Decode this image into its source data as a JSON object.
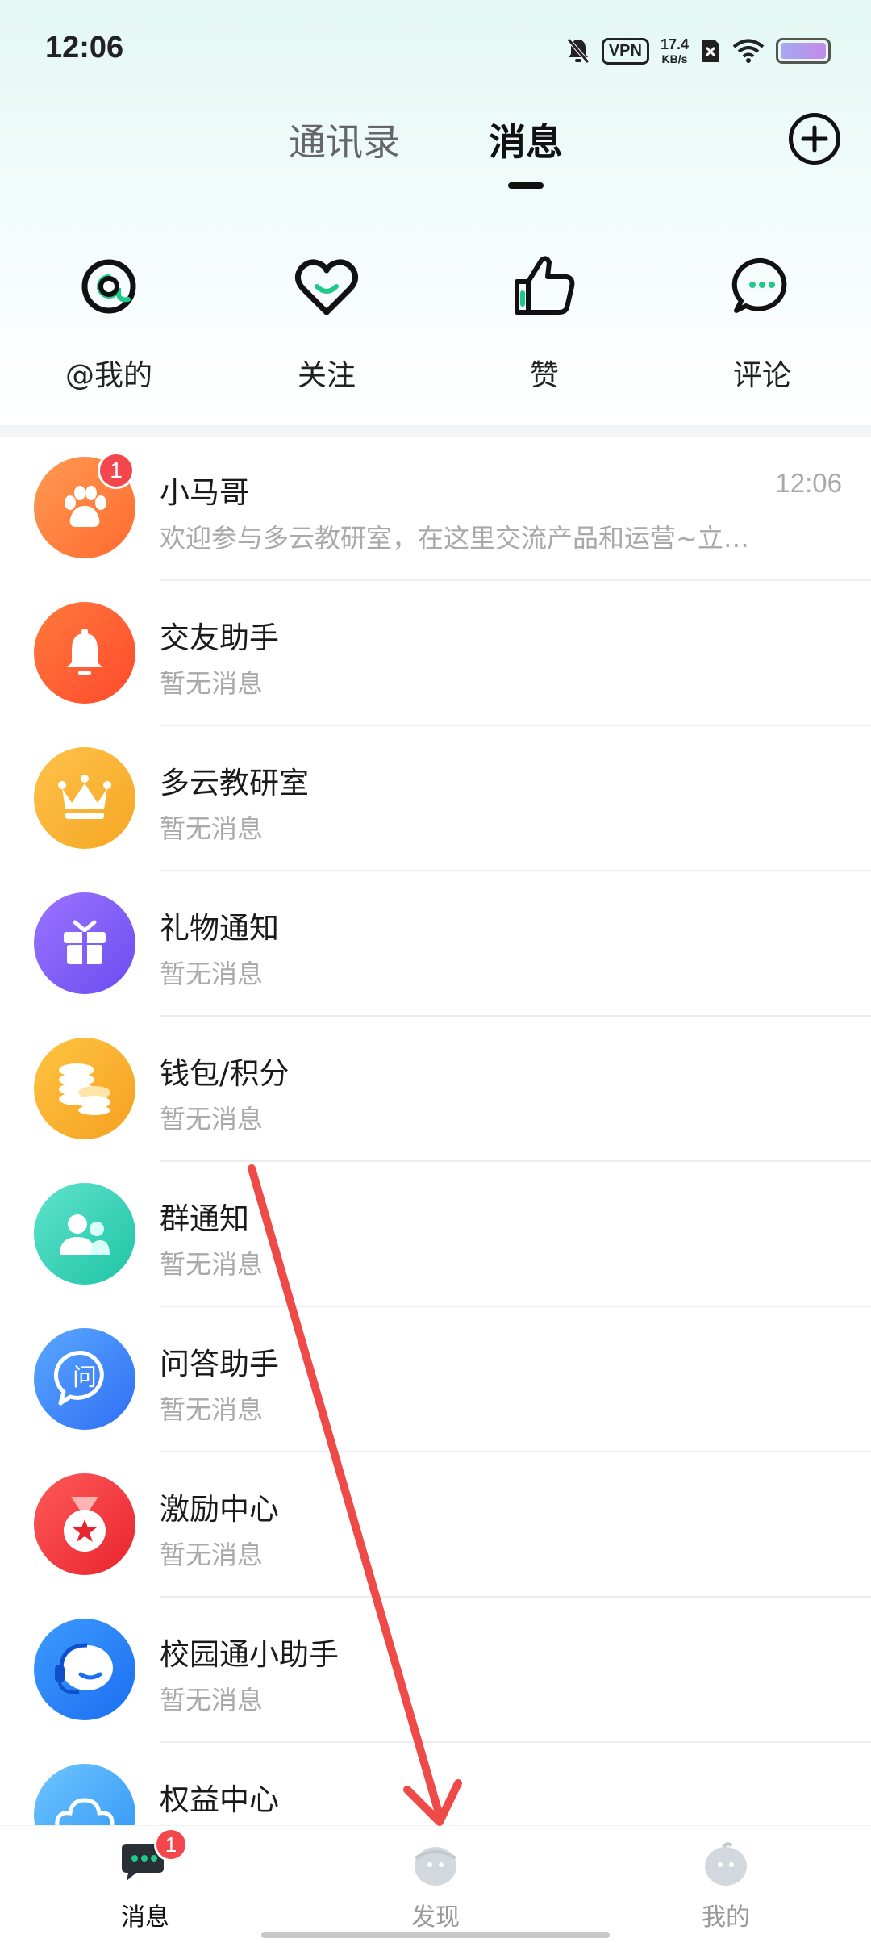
{
  "status_bar": {
    "time": "12:06",
    "vpn": "VPN",
    "speed_value": "17.4",
    "speed_unit": "KB/s"
  },
  "header": {
    "tabs": [
      {
        "label": "通讯录",
        "active": false
      },
      {
        "label": "消息",
        "active": true
      }
    ]
  },
  "quick_actions": [
    {
      "label": "@我的",
      "icon": "at-icon"
    },
    {
      "label": "关注",
      "icon": "heart-icon"
    },
    {
      "label": "赞",
      "icon": "thumbs-up-icon"
    },
    {
      "label": "评论",
      "icon": "comment-icon"
    }
  ],
  "conversations": [
    {
      "title": "小马哥",
      "preview": "欢迎参与多云教研室，在这里交流产品和运营~立…",
      "time": "12:06",
      "badge": "1",
      "color_from": "#ff9a52",
      "color_to": "#ff6a2f",
      "icon": "paw-icon"
    },
    {
      "title": "交友助手",
      "preview": "暂无消息",
      "color_from": "#ff7a3c",
      "color_to": "#ff4a2d",
      "icon": "bell-icon"
    },
    {
      "title": "多云教研室",
      "preview": "暂无消息",
      "color_from": "#ffc24a",
      "color_to": "#f5a623",
      "icon": "crown-icon"
    },
    {
      "title": "礼物通知",
      "preview": "暂无消息",
      "color_from": "#9b74ff",
      "color_to": "#6a4cf0",
      "icon": "gift-icon"
    },
    {
      "title": "钱包/积分",
      "preview": "暂无消息",
      "color_from": "#ffc442",
      "color_to": "#f5a020",
      "icon": "coins-icon"
    },
    {
      "title": "群通知",
      "preview": "暂无消息",
      "color_from": "#5ee3cc",
      "color_to": "#1fc4a6",
      "icon": "group-icon"
    },
    {
      "title": "问答助手",
      "preview": "暂无消息",
      "color_from": "#5aa8ff",
      "color_to": "#2f6ef5",
      "icon": "qa-icon",
      "glyph": "问"
    },
    {
      "title": "激励中心",
      "preview": "暂无消息",
      "color_from": "#ff5a5a",
      "color_to": "#e8242e",
      "icon": "medal-icon"
    },
    {
      "title": "校园通小助手",
      "preview": "暂无消息",
      "color_from": "#3d9bff",
      "color_to": "#1b6ef0",
      "icon": "headset-icon"
    },
    {
      "title": "权益中心",
      "preview": "",
      "color_from": "#6ec6ff",
      "color_to": "#2f93f5",
      "icon": "cloud-icon"
    }
  ],
  "bottom_nav": [
    {
      "label": "消息",
      "badge": "1",
      "active": true
    },
    {
      "label": "发现",
      "active": false
    },
    {
      "label": "我的",
      "active": false
    }
  ],
  "colors": {
    "accent_green": "#1ec98a",
    "badge_red": "#f4474d",
    "annotation_arrow": "#ee4a48"
  }
}
